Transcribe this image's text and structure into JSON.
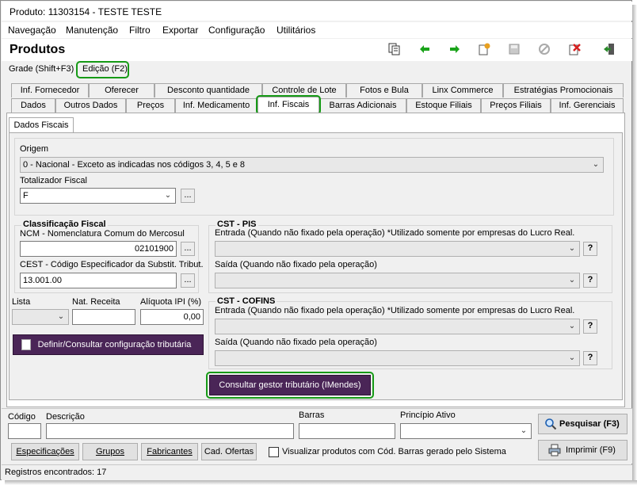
{
  "window": {
    "title": "Produto: 11303154 - TESTE TESTE"
  },
  "menu": [
    {
      "label": "Navegação"
    },
    {
      "label": "Manutenção"
    },
    {
      "label": "Filtro"
    },
    {
      "label": "Exportar"
    },
    {
      "label": "Configuração"
    },
    {
      "label": "Utilitários"
    }
  ],
  "header": {
    "title": "Produtos"
  },
  "toolbar": {
    "icons": [
      "copy-icon",
      "arrow-left-icon",
      "arrow-right-icon",
      "new-icon",
      "save-icon",
      "cancel-icon",
      "delete-icon",
      "exit-icon"
    ],
    "colors": {
      "arrow": "#1aa31a",
      "delete": "#d62020",
      "new": "#e8a020",
      "exit": "#2a8a2a"
    }
  },
  "mode_tabs": [
    {
      "label": "Grade (Shift+F3)"
    },
    {
      "label": "Edição (F2)"
    }
  ],
  "tabs_row1": [
    {
      "label": "Inf. Fornecedor"
    },
    {
      "label": "Oferecer"
    },
    {
      "label": "Desconto quantidade"
    },
    {
      "label": "Controle de Lote"
    },
    {
      "label": "Fotos e Bula"
    },
    {
      "label": "Linx Commerce"
    },
    {
      "label": "Estratégias Promocionais"
    }
  ],
  "tabs_row2": [
    {
      "label": "Dados"
    },
    {
      "label": "Outros Dados"
    },
    {
      "label": "Preços"
    },
    {
      "label": "Inf. Medicamento"
    },
    {
      "label": "Inf. Fiscais"
    },
    {
      "label": "Barras Adicionais"
    },
    {
      "label": "Estoque Filiais"
    },
    {
      "label": "Preços Filiais"
    },
    {
      "label": "Inf. Gerenciais"
    }
  ],
  "subtab": {
    "label": "Dados Fiscais"
  },
  "fiscal": {
    "origem_label": "Origem",
    "origem_value": "0 - Nacional - Exceto as indicadas nos códigos 3, 4, 5 e 8",
    "totalizador_label": "Totalizador Fiscal",
    "totalizador_value": "F",
    "classificacao_title": "Classificação Fiscal",
    "ncm_label": "NCM - Nomenclatura Comum do Mercosul",
    "ncm_value": "02101900",
    "cest_label": "CEST - Código Especificador da Substit. Tribut.",
    "cest_value": "13.001.00",
    "lista_label": "Lista",
    "nat_receita_label": "Nat. Receita",
    "aliquota_label": "Alíquota IPI (%)",
    "aliquota_value": "0,00",
    "definir_button": "Definir/Consultar configuração tributária",
    "consultar_button": "Consultar gestor tributário (IMendes)",
    "ellipsis": "...",
    "help": "?"
  },
  "pis": {
    "title": "CST - PIS",
    "entrada_label": "Entrada (Quando não fixado pela operação) *Utilizado somente por empresas do Lucro Real.",
    "saida_label": "Saída (Quando não fixado pela operação)"
  },
  "cofins": {
    "title": "CST - COFINS",
    "entrada_label": "Entrada (Quando não fixado pela operação) *Utilizado somente por empresas do Lucro Real.",
    "saida_label": "Saída (Quando não fixado pela operação)"
  },
  "search": {
    "codigo_label": "Código",
    "descricao_label": "Descrição",
    "barras_label": "Barras",
    "principio_label": "Princípio Ativo",
    "pesquisar_button": "Pesquisar (F3)",
    "imprimir_button": "Imprimir (F9)",
    "especificacoes_button": "Especificações",
    "grupos_button": "Grupos",
    "fabricantes_button": "Fabricantes",
    "ofertas_button": "Cad. Ofertas",
    "checkbox_label": "Visualizar produtos com Cód. Barras gerado pelo Sistema"
  },
  "status": {
    "text": "Registros encontrados: 17"
  },
  "colors": {
    "highlight": "#169a16",
    "purple": "#4a2557"
  }
}
